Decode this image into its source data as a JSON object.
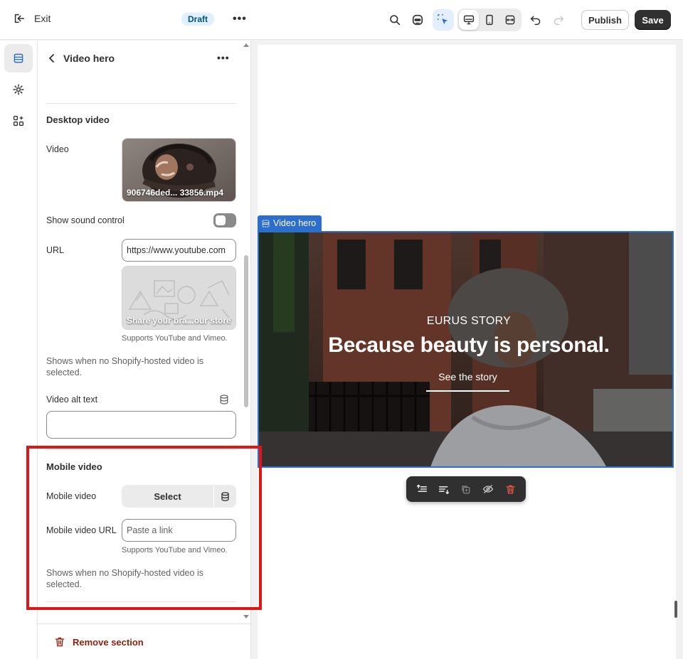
{
  "topbar": {
    "exit_label": "Exit",
    "status_badge": "Draft",
    "more_label": "•••",
    "publish_label": "Publish",
    "save_label": "Save"
  },
  "panel": {
    "title": "Video hero",
    "more_label": "•••",
    "desktop": {
      "section_title": "Desktop video",
      "video_label": "Video",
      "video_filename": "906746ded... 33856.mp4",
      "sound_label": "Show sound control",
      "sound_enabled": false,
      "url_label": "URL",
      "url_value": "https://www.youtube.com",
      "url_preview_caption": "Share your bra...our store",
      "url_help": "Supports YouTube and Vimeo.",
      "fallback_help": "Shows when no Shopify-hosted video is selected.",
      "alt_label": "Video alt text",
      "alt_value": ""
    },
    "mobile": {
      "section_title": "Mobile video",
      "video_label": "Mobile video",
      "select_label": "Select",
      "url_label": "Mobile video URL",
      "url_placeholder": "Paste a link",
      "url_help": "Supports YouTube and Vimeo.",
      "fallback_help": "Shows when no Shopify-hosted video is selected."
    },
    "remove_label": "Remove section"
  },
  "preview": {
    "section_tag": "Video hero",
    "hero_subheading": "EURUS STORY",
    "hero_heading": "Because beauty is personal.",
    "hero_link": "See the story"
  },
  "colors": {
    "accent": "#2c6ecb",
    "highlight": "#e01515",
    "save_bg": "#303030",
    "danger": "#8e1f0b"
  }
}
